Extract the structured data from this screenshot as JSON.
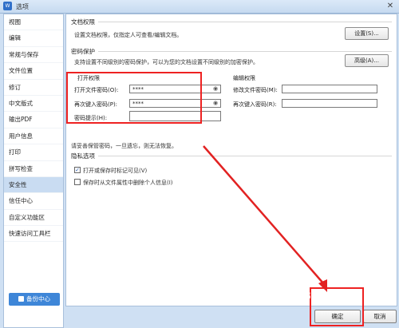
{
  "window": {
    "title": "选项",
    "close_glyph": "✕",
    "app_icon": "W"
  },
  "sidebar": {
    "items": [
      "视图",
      "编辑",
      "常规与保存",
      "文件位置",
      "修订",
      "中文版式",
      "输出PDF",
      "用户信息",
      "打印",
      "拼写检查",
      "安全性",
      "信任中心",
      "自定义功能区",
      "快速访问工具栏"
    ],
    "active_index": 10,
    "backup_label": "备份中心"
  },
  "doc_permissions": {
    "title": "文档权限",
    "description": "设置文档权限，仅指定人可查看/编辑文档。",
    "button": "设置(S)..."
  },
  "password_protection": {
    "title": "密码保护",
    "description": "支持设置不同级别的密码保护，可以为您的文档设置不同级别的加密保护。",
    "button": "高级(A)...",
    "open_section": {
      "title": "打开权限",
      "open_password_label": "打开文件密码(O):",
      "open_password_value": "****",
      "reenter_label": "再次键入密码(P):",
      "reenter_value": "****",
      "hint_label": "密码提示(H):",
      "hint_value": ""
    },
    "edit_section": {
      "title": "编辑权限",
      "modify_password_label": "修改文件密码(M):",
      "reenter_label": "再次键入密码(R):"
    },
    "warning": "请妥善保管密码，一旦遗忘，则无法恢复。"
  },
  "privacy": {
    "title": "隐私选项",
    "option1": "打开或保存时标记可见(V)",
    "option1_checked": true,
    "option2": "保存时从文件属性中删除个人信息(I)",
    "option2_checked": false
  },
  "footer": {
    "ok": "确定",
    "cancel": "取消"
  },
  "watermark": "Bai 经验",
  "colors": {
    "highlight_red": "#e22222",
    "active_item": "#c9dcf2",
    "accent_blue": "#3e86d8"
  }
}
